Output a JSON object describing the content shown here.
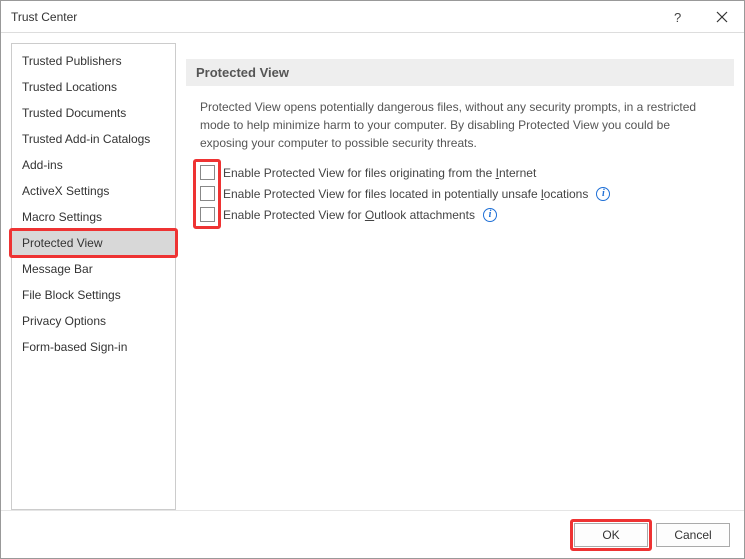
{
  "window": {
    "title": "Trust Center"
  },
  "sidebar": {
    "items": [
      {
        "label": "Trusted Publishers"
      },
      {
        "label": "Trusted Locations"
      },
      {
        "label": "Trusted Documents"
      },
      {
        "label": "Trusted Add-in Catalogs"
      },
      {
        "label": "Add-ins"
      },
      {
        "label": "ActiveX Settings"
      },
      {
        "label": "Macro Settings"
      },
      {
        "label": "Protected View"
      },
      {
        "label": "Message Bar"
      },
      {
        "label": "File Block Settings"
      },
      {
        "label": "Privacy Options"
      },
      {
        "label": "Form-based Sign-in"
      }
    ],
    "selected_index": 7
  },
  "section": {
    "header": "Protected View",
    "description": "Protected View opens potentially dangerous files, without any security prompts, in a restricted mode to help minimize harm to your computer. By disabling Protected View you could be exposing your computer to possible security threats.",
    "checks": [
      {
        "pre": "Enable Protected View for files originating from the ",
        "u": "I",
        "post": "nternet",
        "info": false,
        "checked": false
      },
      {
        "pre": "Enable Protected View for files located in potentially unsafe ",
        "u": "l",
        "post": "ocations",
        "info": true,
        "checked": false
      },
      {
        "pre": "Enable Protected View for ",
        "u": "O",
        "post": "utlook attachments",
        "info": true,
        "checked": false
      }
    ]
  },
  "buttons": {
    "ok": "OK",
    "cancel": "Cancel"
  },
  "info_glyph": "i"
}
